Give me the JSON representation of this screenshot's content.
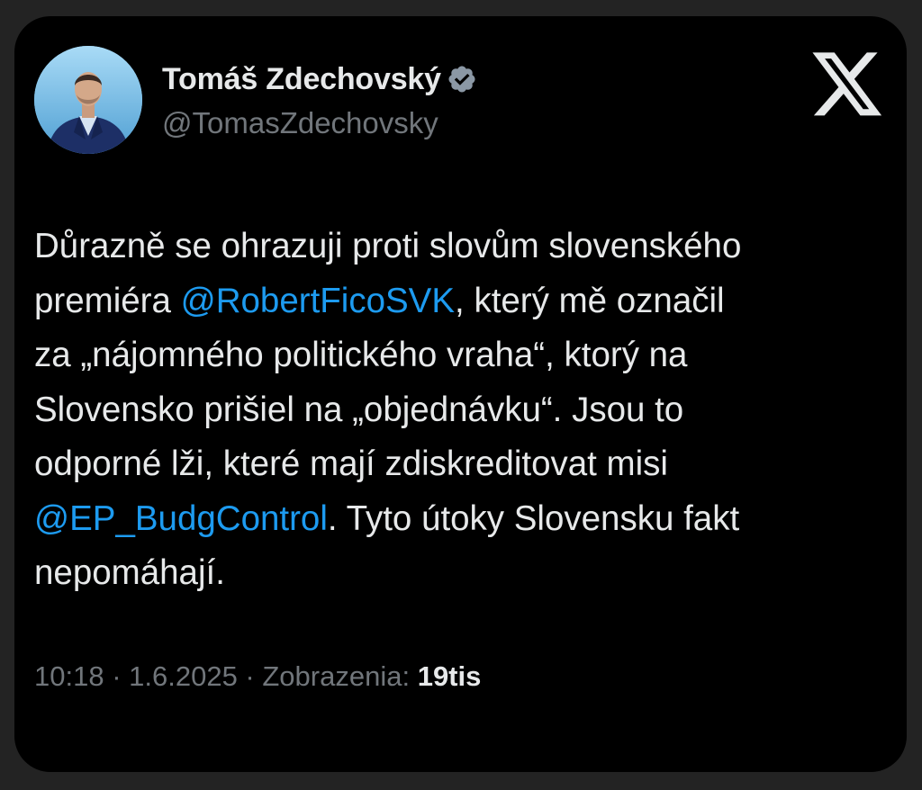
{
  "author": {
    "display_name": "Tomáš Zdechovský",
    "handle": "@TomasZdechovsky",
    "verified_icon": "verified-badge-icon"
  },
  "platform_icon": "x-logo-icon",
  "tweet": {
    "lines": [
      [
        {
          "text": "Důrazně se ohrazuji proti slovům slovenského"
        }
      ],
      [
        {
          "text": "premiéra "
        },
        {
          "text": "@RobertFicoSVK",
          "mention": true
        },
        {
          "text": ", který mě označil"
        }
      ],
      [
        {
          "text": "za „nájomného politického vraha“, ktorý na"
        }
      ],
      [
        {
          "text": "Slovensko prišiel na „objednávku“. Jsou to"
        }
      ],
      [
        {
          "text": "odporné lži, které mají zdiskreditovat misi"
        }
      ],
      [
        {
          "text": "@EP_BudgControl",
          "mention": true
        },
        {
          "text": ". Tyto útoky Slovensku fakt"
        }
      ],
      [
        {
          "text": "nepomáhají."
        }
      ]
    ]
  },
  "meta": {
    "time": "10:18",
    "separator": " · ",
    "date": "1.6.2025",
    "views_label": "Zobrazenia: ",
    "views_count": "19tis"
  },
  "colors": {
    "background": "#000000",
    "text": "#e7e9ea",
    "secondary_text": "#71767b",
    "mention": "#1d9bf0",
    "outer": "#232323"
  }
}
